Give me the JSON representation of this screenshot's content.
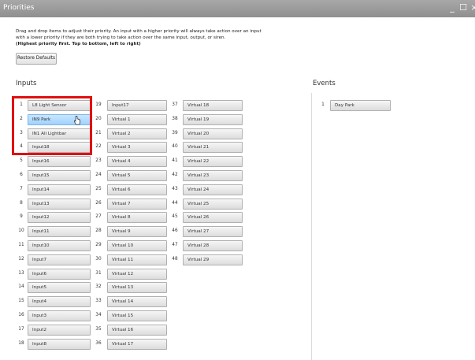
{
  "window": {
    "title": "Priorities",
    "controls": [
      "_",
      "☐",
      "×"
    ]
  },
  "description": {
    "line1": "Drag and drop items to adjust their priority. An input with a higher priority will always take action over an input",
    "line2": "with a lower priority if they are both trying to take action over the same input, output, or siren.",
    "line3": "(Highest priority first. Top to bottom, left to right)"
  },
  "restore_label": "Restore Defaults",
  "inputs": {
    "heading": "Inputs",
    "columns": [
      [
        {
          "num": "1",
          "label": "L8 Light Sensor"
        },
        {
          "num": "2",
          "label": "IN9 Park",
          "selected": true
        },
        {
          "num": "3",
          "label": "IN1 All Lightbar"
        },
        {
          "num": "4",
          "label": "Input18"
        },
        {
          "num": "5",
          "label": "Input16"
        },
        {
          "num": "6",
          "label": "Input15"
        },
        {
          "num": "7",
          "label": "Input14"
        },
        {
          "num": "8",
          "label": "Input13"
        },
        {
          "num": "9",
          "label": "Input12"
        },
        {
          "num": "10",
          "label": "Input11"
        },
        {
          "num": "11",
          "label": "Input10"
        },
        {
          "num": "12",
          "label": "Input7"
        },
        {
          "num": "13",
          "label": "Input6"
        },
        {
          "num": "14",
          "label": "Input5"
        },
        {
          "num": "15",
          "label": "Input4"
        },
        {
          "num": "16",
          "label": "Input3"
        },
        {
          "num": "17",
          "label": "Input2"
        },
        {
          "num": "18",
          "label": "Input8"
        }
      ],
      [
        {
          "num": "19",
          "label": "Input17"
        },
        {
          "num": "20",
          "label": "Virtual 1"
        },
        {
          "num": "21",
          "label": "Virtual 2"
        },
        {
          "num": "22",
          "label": "Virtual 3"
        },
        {
          "num": "23",
          "label": "Virtual 4"
        },
        {
          "num": "24",
          "label": "Virtual 5"
        },
        {
          "num": "25",
          "label": "Virtual 6"
        },
        {
          "num": "26",
          "label": "Virtual 7"
        },
        {
          "num": "27",
          "label": "Virtual 8"
        },
        {
          "num": "28",
          "label": "Virtual 9"
        },
        {
          "num": "29",
          "label": "Virtual 10"
        },
        {
          "num": "30",
          "label": "Virtual 11"
        },
        {
          "num": "31",
          "label": "Virtual 12"
        },
        {
          "num": "32",
          "label": "Virtual 13"
        },
        {
          "num": "33",
          "label": "Virtual 14"
        },
        {
          "num": "34",
          "label": "Virtual 15"
        },
        {
          "num": "35",
          "label": "Virtual 16"
        },
        {
          "num": "36",
          "label": "Virtual 17"
        }
      ],
      [
        {
          "num": "37",
          "label": "Virtual 18"
        },
        {
          "num": "38",
          "label": "Virtual 19"
        },
        {
          "num": "39",
          "label": "Virtual 20"
        },
        {
          "num": "40",
          "label": "Virtual 21"
        },
        {
          "num": "41",
          "label": "Virtual 22"
        },
        {
          "num": "42",
          "label": "Virtual 23"
        },
        {
          "num": "43",
          "label": "Virtual 24"
        },
        {
          "num": "44",
          "label": "Virtual 25"
        },
        {
          "num": "45",
          "label": "Virtual 26"
        },
        {
          "num": "46",
          "label": "Virtual 27"
        },
        {
          "num": "47",
          "label": "Virtual 28"
        },
        {
          "num": "48",
          "label": "Virtual 29"
        }
      ]
    ]
  },
  "events": {
    "heading": "Events",
    "items": [
      {
        "num": "1",
        "label": "Day Park"
      }
    ]
  },
  "colors": {
    "titlebar": "#999999",
    "selected_item": "#9fd2ff",
    "highlight_box": "#e01010"
  }
}
